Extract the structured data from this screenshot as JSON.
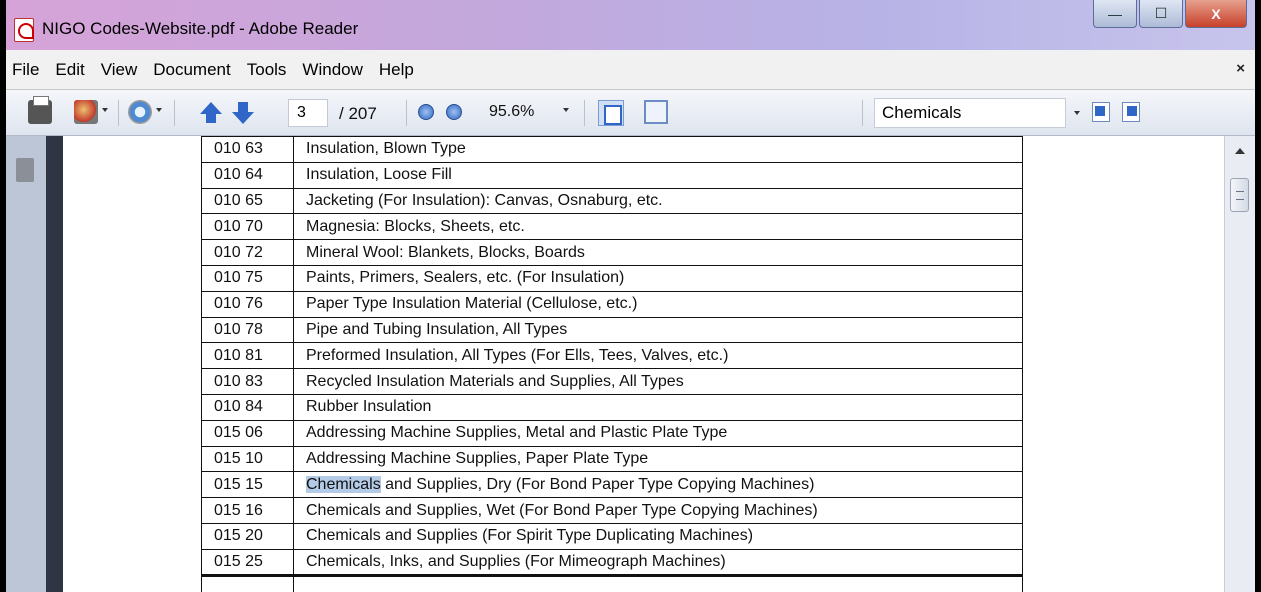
{
  "window": {
    "title": "NIGO Codes-Website.pdf - Adobe Reader",
    "controls": {
      "minimize": "—",
      "maximize": "☐",
      "close": "X"
    }
  },
  "menubar": {
    "items": [
      "File",
      "Edit",
      "View",
      "Document",
      "Tools",
      "Window",
      "Help"
    ],
    "close": "×"
  },
  "toolbar": {
    "page_current": "3",
    "page_total": "/ 207",
    "zoom": "95.6%",
    "search_value": "Chemicals"
  },
  "table": {
    "rows": [
      {
        "code": "010 63",
        "desc": "Insulation, Blown Type"
      },
      {
        "code": "010 64",
        "desc": "Insulation, Loose Fill"
      },
      {
        "code": "010 65",
        "desc": "Jacketing (For Insulation): Canvas, Osnaburg, etc."
      },
      {
        "code": "010 70",
        "desc": "Magnesia: Blocks, Sheets, etc."
      },
      {
        "code": "010 72",
        "desc": "Mineral Wool: Blankets, Blocks, Boards"
      },
      {
        "code": "010 75",
        "desc": "Paints, Primers, Sealers, etc. (For Insulation)"
      },
      {
        "code": "010 76",
        "desc": "Paper Type Insulation Material (Cellulose, etc.)"
      },
      {
        "code": "010 78",
        "desc": "Pipe and Tubing Insulation, All Types"
      },
      {
        "code": "010 81",
        "desc": "Preformed Insulation, All Types (For Ells, Tees, Valves, etc.)"
      },
      {
        "code": "010 83",
        "desc": "Recycled Insulation Materials and Supplies, All Types"
      },
      {
        "code": "010 84",
        "desc": "Rubber Insulation"
      },
      {
        "code": "015 06",
        "desc": "Addressing Machine Supplies, Metal and Plastic Plate Type"
      },
      {
        "code": "015 10",
        "desc": "Addressing Machine Supplies, Paper Plate Type"
      },
      {
        "code": "015 15",
        "desc_highlight": "Chemicals",
        "desc_rest": " and Supplies, Dry (For Bond Paper Type Copying Machines)"
      },
      {
        "code": "015 16",
        "desc": "Chemicals and Supplies, Wet (For Bond Paper Type Copying Machines)"
      },
      {
        "code": "015 20",
        "desc": "Chemicals and Supplies (For Spirit Type Duplicating Machines)"
      },
      {
        "code": "015 25",
        "desc": "Chemicals, Inks, and Supplies (For Mimeograph Machines)"
      }
    ]
  },
  "colors": {
    "highlight": "#b3cbe6",
    "toolbar_blue": "#2f66c8"
  },
  "icons": [
    "pdf-app-icon",
    "print-icon",
    "create-pdf-icon",
    "collaborate-icon",
    "previous-page-icon",
    "next-page-icon",
    "zoom-out-icon",
    "zoom-in-icon",
    "fit-page-icon",
    "full-screen-icon",
    "find-previous-icon",
    "find-next-icon",
    "pages-panel-icon"
  ]
}
